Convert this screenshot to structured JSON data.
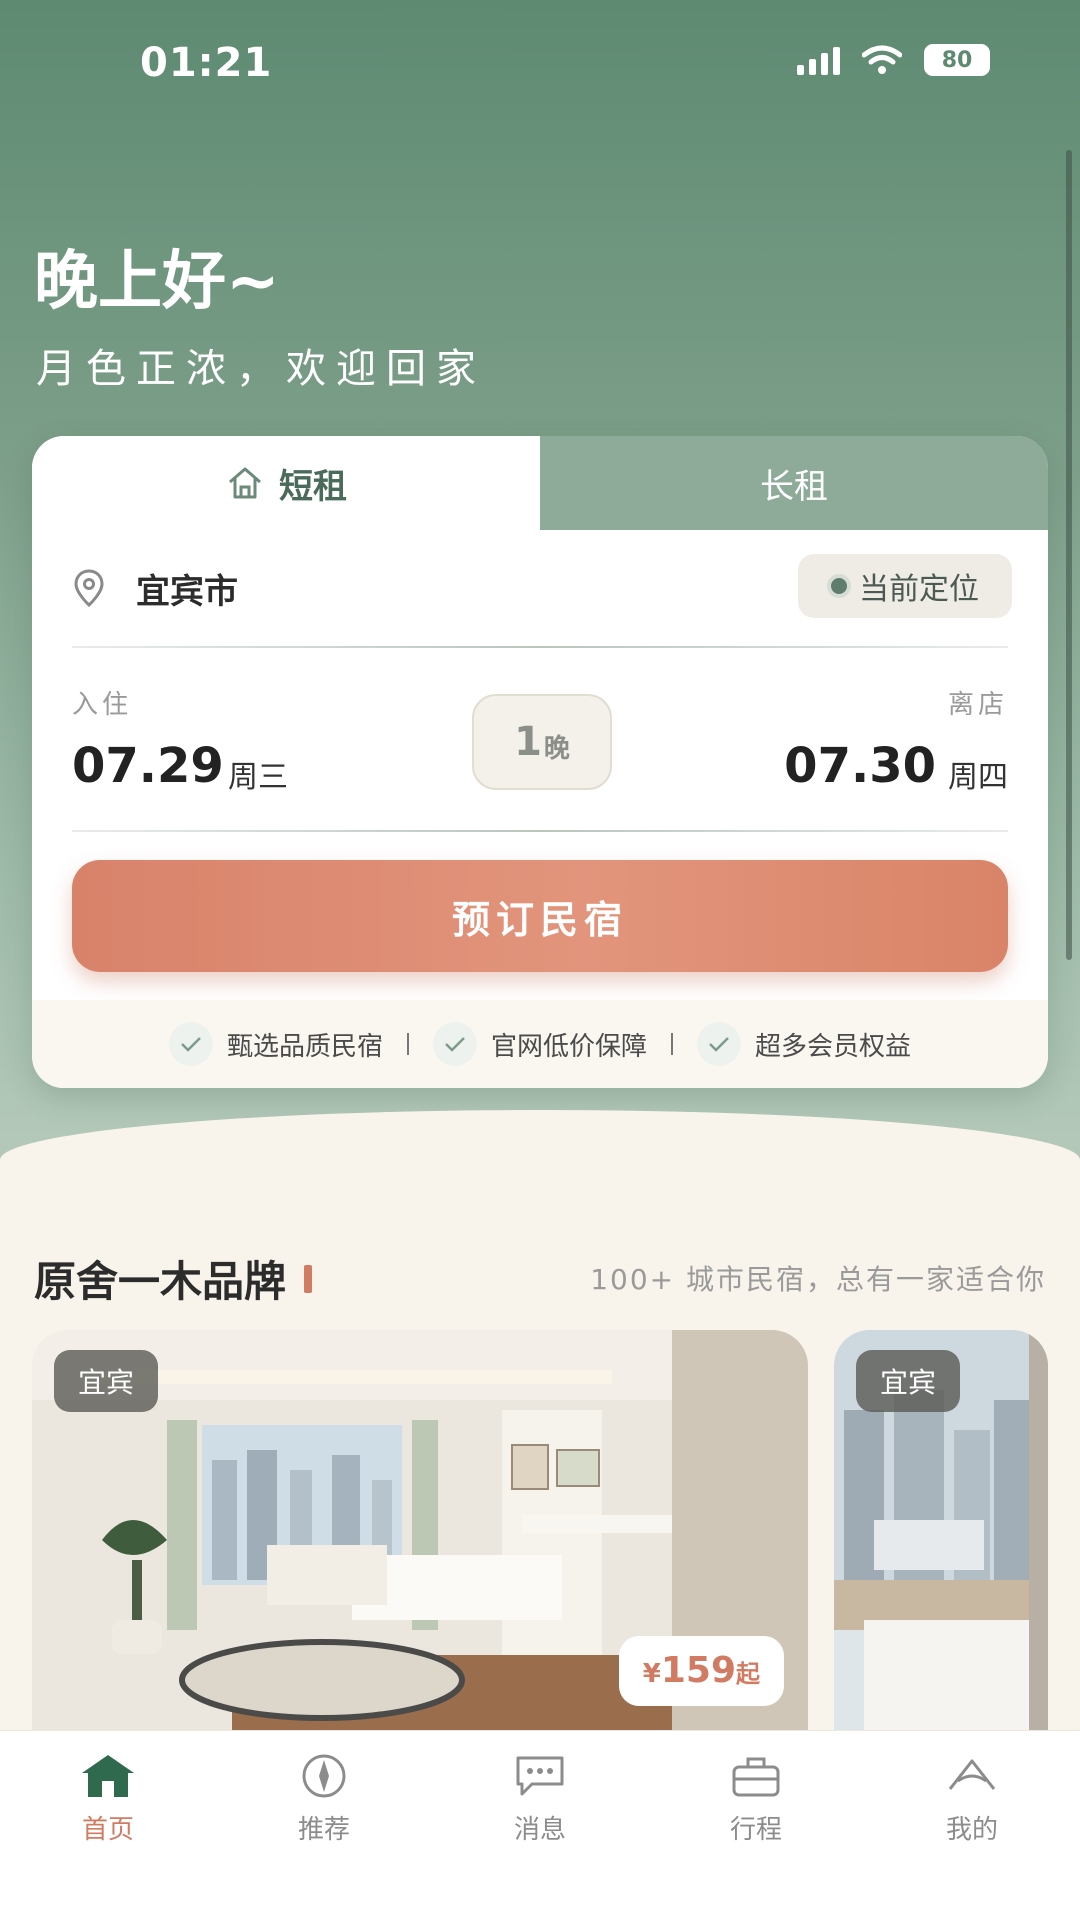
{
  "status_bar": {
    "time": "01:21",
    "battery": "80"
  },
  "greeting": {
    "title": "晚上好~",
    "subtitle": "月色正浓，欢迎回家"
  },
  "booking": {
    "tabs": {
      "short": "短租",
      "long": "长租"
    },
    "city": "宜宾市",
    "locate_label": "当前定位",
    "checkin": {
      "label": "入住",
      "date": "07.29",
      "weekday": "周三"
    },
    "checkout": {
      "label": "离店",
      "date": "07.30",
      "weekday": "周四"
    },
    "nights": {
      "count": "1",
      "unit": "晚"
    },
    "book_button": "预订民宿",
    "features": [
      "甄选品质民宿",
      "官网低价保障",
      "超多会员权益"
    ]
  },
  "brand": {
    "title": "原舍一木品牌",
    "subtitle": "100+ 城市民宿，总有一家适合你",
    "rooms": [
      {
        "city": "宜宾",
        "price_symbol": "¥",
        "price": "159",
        "price_suffix": "起"
      },
      {
        "city": "宜宾"
      }
    ]
  },
  "tabbar": {
    "items": [
      {
        "label": "首页",
        "icon": "home-icon"
      },
      {
        "label": "推荐",
        "icon": "compass-icon"
      },
      {
        "label": "消息",
        "icon": "chat-icon"
      },
      {
        "label": "行程",
        "icon": "suitcase-icon"
      },
      {
        "label": "我的",
        "icon": "profile-icon"
      }
    ]
  },
  "colors": {
    "primary_green": "#5e8a72",
    "accent": "#d27b63",
    "cream": "#f8f4eb"
  }
}
